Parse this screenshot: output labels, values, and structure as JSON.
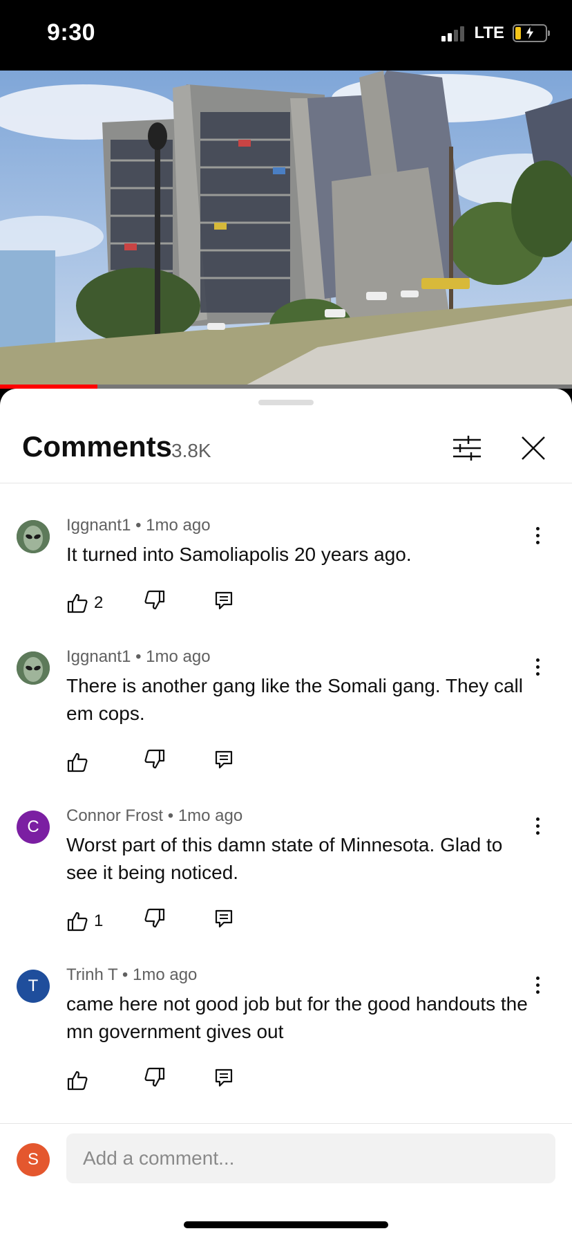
{
  "status_bar": {
    "time": "9:30",
    "network": "LTE"
  },
  "video": {
    "progress_fraction": 0.17
  },
  "comments_panel": {
    "title": "Comments",
    "count": "3.8K"
  },
  "comments": [
    {
      "author": "Iggnant1",
      "separator": "•",
      "time": "1mo ago",
      "text": "It turned into Samoliapolis 20 years ago.",
      "likes": "2",
      "avatar_letter": "",
      "avatar_color": "#4a6b4a"
    },
    {
      "author": "Iggnant1",
      "separator": "•",
      "time": "1mo ago",
      "text": "There is another gang like the Somali gang. They call em cops.",
      "likes": "",
      "avatar_letter": "",
      "avatar_color": "#4a6b4a"
    },
    {
      "author": "Connor Frost",
      "separator": "•",
      "time": "1mo ago",
      "text": "Worst part of this damn state of Minnesota. Glad to see it being noticed.",
      "likes": "1",
      "avatar_letter": "C",
      "avatar_color": "#7b1fa2"
    },
    {
      "author": "Trinh T",
      "separator": "•",
      "time": "1mo ago",
      "text": "came here not good job but for the good handouts the mn government gives out",
      "likes": "",
      "avatar_letter": "T",
      "avatar_color": "#1f4e9c"
    }
  ],
  "add_comment": {
    "placeholder": "Add a comment...",
    "user_letter": "S",
    "user_color": "#e4572e"
  }
}
